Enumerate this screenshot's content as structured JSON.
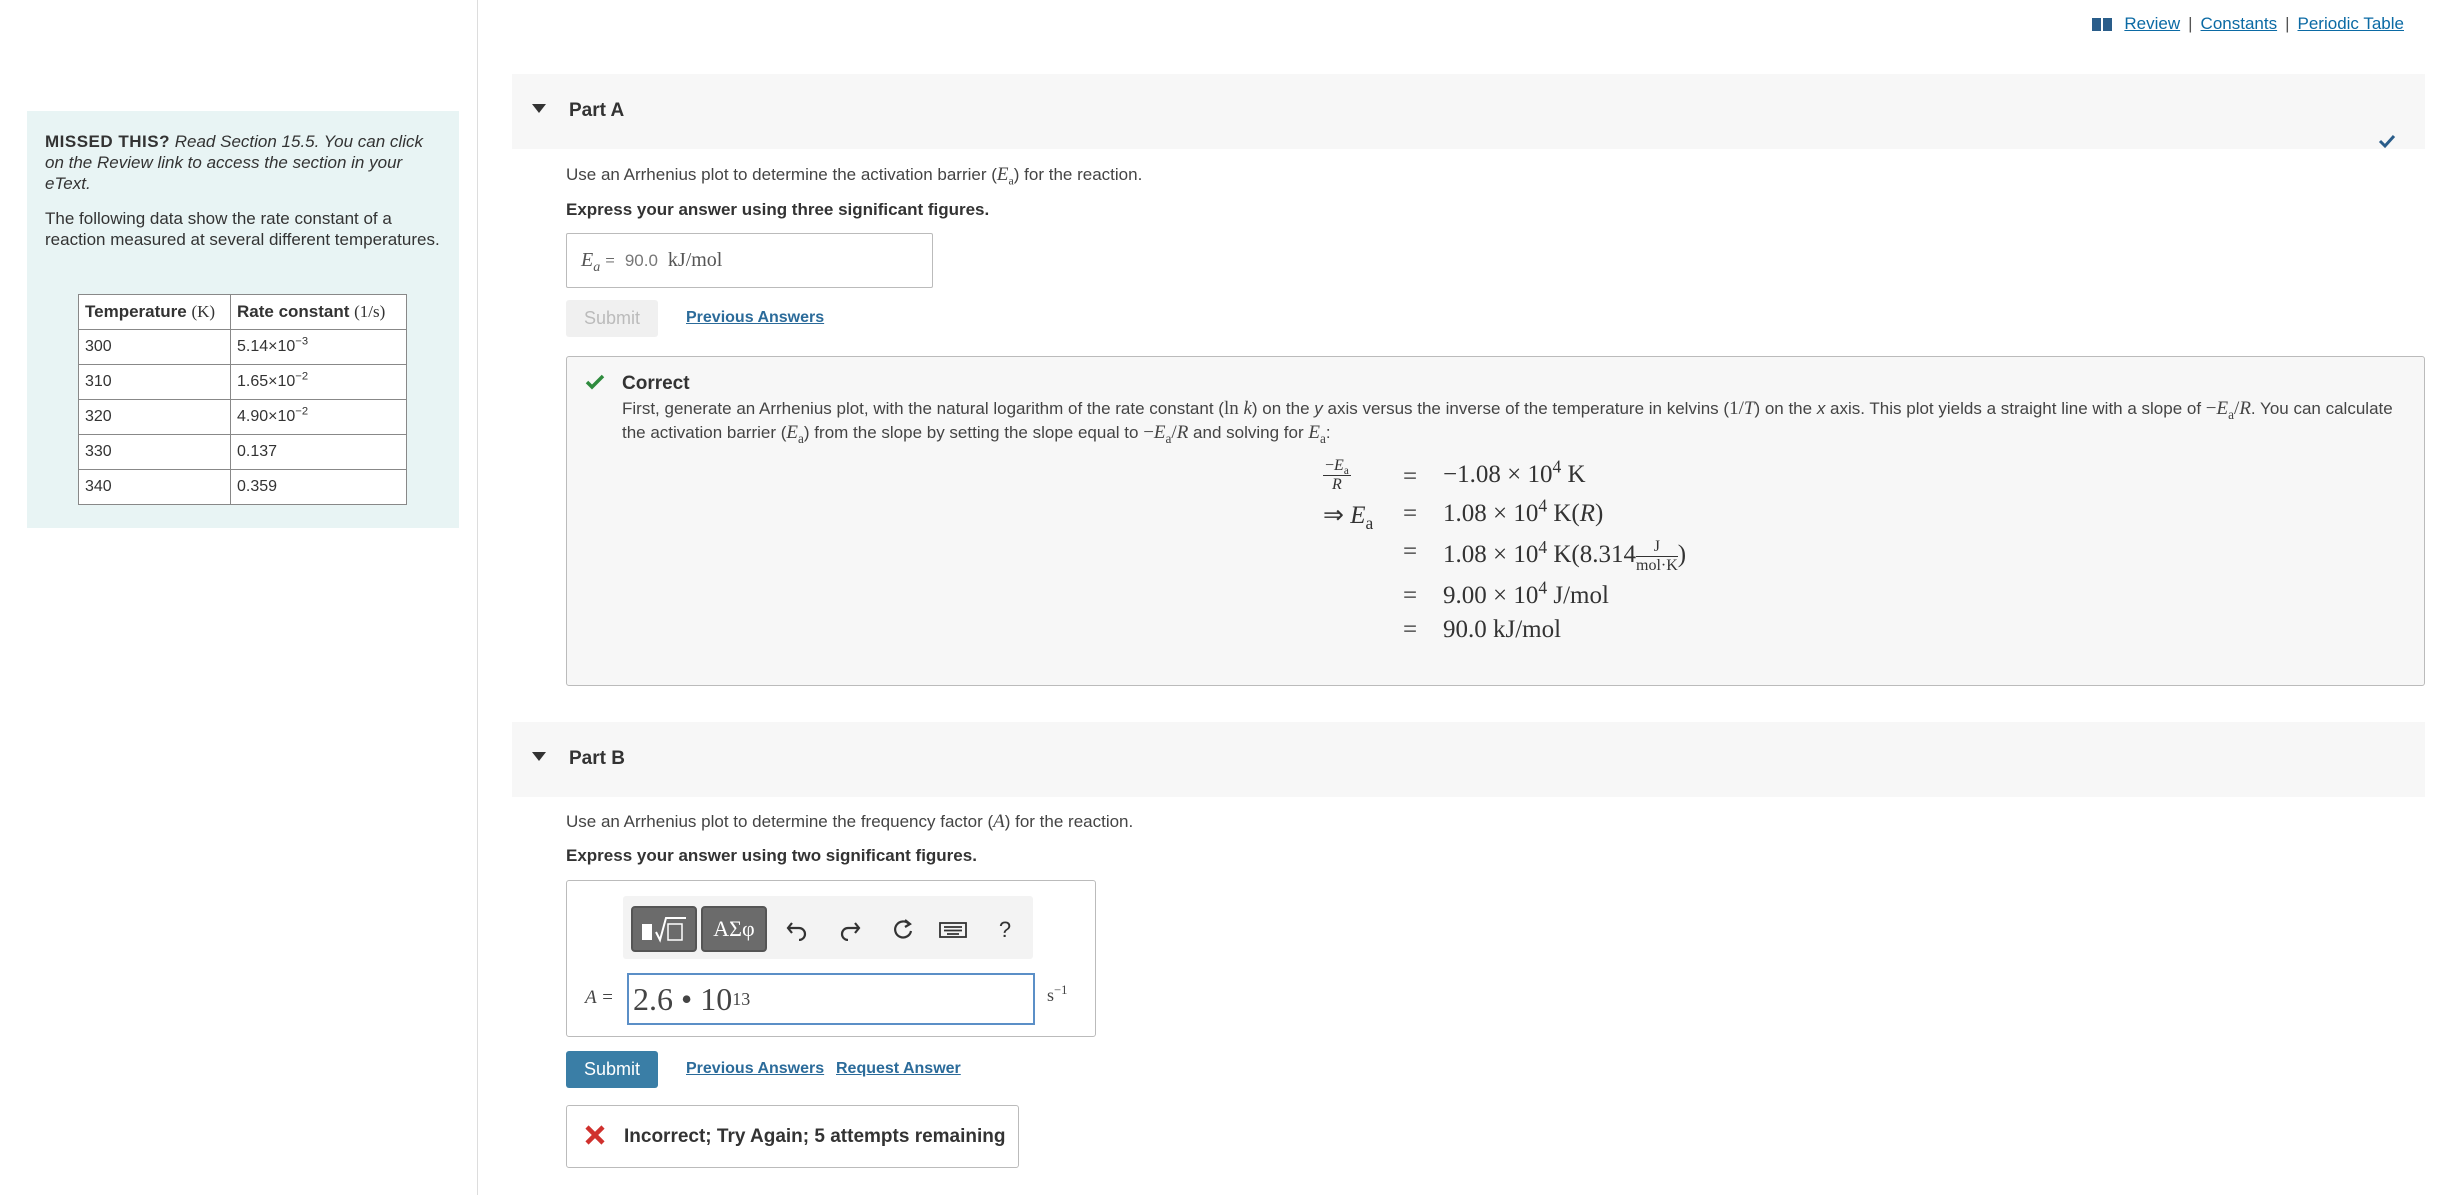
{
  "header": {
    "review": "Review",
    "constants": "Constants",
    "periodic_table": "Periodic Table",
    "separator": "|"
  },
  "sidebar": {
    "missed_label": "MISSED THIS?",
    "missed_text": "Read Section 15.5. You can click on the Review link to access the section in your eText.",
    "intro": "The following data show the rate constant of a reaction measured at several different temperatures.",
    "table": {
      "headers": [
        "Temperature (K)",
        "Rate constant (1/s)"
      ],
      "rows": [
        [
          "300",
          "5.14×10",
          "−3"
        ],
        [
          "310",
          "1.65×10",
          "−2"
        ],
        [
          "320",
          "4.90×10",
          "−2"
        ],
        [
          "330",
          "0.137",
          ""
        ],
        [
          "340",
          "0.359",
          ""
        ]
      ]
    }
  },
  "partA": {
    "title": "Part A",
    "question": "Use an Arrhenius plot to determine the activation barrier (Ea) for the reaction.",
    "instruction": "Express your answer using three significant figures.",
    "answer_label": "Ea =",
    "answer_value": "90.0",
    "answer_units": "kJ/mol",
    "submit": "Submit",
    "previous_answers": "Previous Answers",
    "feedback": {
      "status": "Correct",
      "explanation": "First, generate an Arrhenius plot, with the natural logarithm of the rate constant (ln k) on the y axis versus the inverse of the temperature in kelvins (1/T) on the x axis. This plot yields a straight line with a slope of −Ea/R. You can calculate the activation barrier (Ea) from the slope by setting the slope equal to −Ea/R and solving for Ea:",
      "math": [
        {
          "lhs": "−Ea/R",
          "rhs": "−1.08 × 10⁴ K"
        },
        {
          "lhs": "⇒ Ea",
          "rhs": "1.08 × 10⁴ K(R)"
        },
        {
          "lhs": "",
          "rhs": "1.08 × 10⁴ K(8.314 J/mol·K)"
        },
        {
          "lhs": "",
          "rhs": "9.00 × 10⁴ J/mol"
        },
        {
          "lhs": "",
          "rhs": "90.0 kJ/mol"
        }
      ]
    }
  },
  "partB": {
    "title": "Part B",
    "question": "Use an Arrhenius plot to determine the frequency factor (A) for the reaction.",
    "instruction": "Express your answer using two significant figures.",
    "toolbar": {
      "symbols": "ΑΣφ",
      "help": "?"
    },
    "answer_label": "A =",
    "answer_value": "2.6 • 10",
    "answer_exponent": "13",
    "answer_units": "s",
    "answer_units_exp": "−1",
    "submit": "Submit",
    "previous_answers": "Previous Answers",
    "request_answer": "Request Answer",
    "feedback": {
      "status": "Incorrect; Try Again; 5 attempts remaining"
    }
  },
  "colors": {
    "link": "#0b6aa4",
    "submit_active": "#3a7ea6",
    "correct_green": "#2e8b3d",
    "incorrect_red": "#d0312d",
    "info_bg": "#e8f4f4"
  }
}
